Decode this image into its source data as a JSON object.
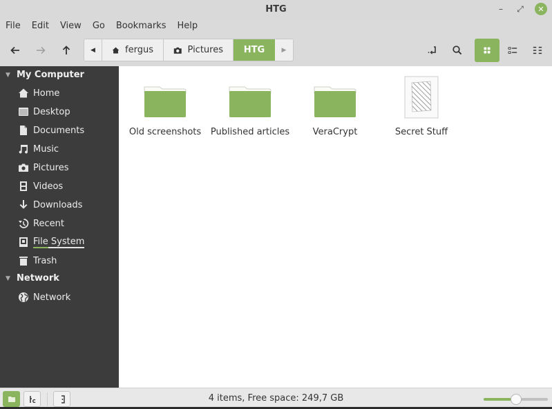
{
  "window": {
    "title": "HTG",
    "minimize_label": "–",
    "maximize_label": "⤢",
    "close_label": "✕"
  },
  "menu": [
    {
      "label": "File"
    },
    {
      "label": "Edit"
    },
    {
      "label": "View"
    },
    {
      "label": "Go"
    },
    {
      "label": "Bookmarks"
    },
    {
      "label": "Help"
    }
  ],
  "toolbar": {
    "back_icon": "arrow-left",
    "forward_icon": "arrow-right",
    "up_icon": "arrow-up",
    "pathbar": {
      "left_arrow": "◀",
      "right_arrow": "▶",
      "crumbs": [
        {
          "label": "fergus",
          "icon": "home-icon"
        },
        {
          "label": "Pictures",
          "icon": "camera-icon"
        },
        {
          "label": "HTG",
          "icon": "",
          "current": true
        }
      ]
    },
    "view_mode": "icons"
  },
  "sidebar": {
    "sections": [
      {
        "title": "My Computer",
        "items": [
          {
            "label": "Home",
            "icon": "home-icon"
          },
          {
            "label": "Desktop",
            "icon": "desktop-icon"
          },
          {
            "label": "Documents",
            "icon": "document-icon"
          },
          {
            "label": "Music",
            "icon": "music-icon"
          },
          {
            "label": "Pictures",
            "icon": "camera-icon"
          },
          {
            "label": "Videos",
            "icon": "film-icon"
          },
          {
            "label": "Downloads",
            "icon": "download-icon"
          },
          {
            "label": "Recent",
            "icon": "recent-icon"
          },
          {
            "label": "File System",
            "icon": "drive-icon"
          },
          {
            "label": "Trash",
            "icon": "trash-icon"
          }
        ]
      },
      {
        "title": "Network",
        "items": [
          {
            "label": "Network",
            "icon": "globe-icon"
          }
        ]
      }
    ]
  },
  "files": [
    {
      "name": "Old screenshots",
      "type": "folder"
    },
    {
      "name": "Published articles",
      "type": "folder"
    },
    {
      "name": "VeraCrypt",
      "type": "folder"
    },
    {
      "name": "Secret Stuff",
      "type": "file"
    }
  ],
  "statusbar": {
    "text": "4 items, Free space: 249,7 GB",
    "zoom_level": 0.5
  },
  "colors": {
    "accent": "#8ab45e",
    "sidebar_bg": "#3c3c3c",
    "content_bg": "#ffffff"
  }
}
